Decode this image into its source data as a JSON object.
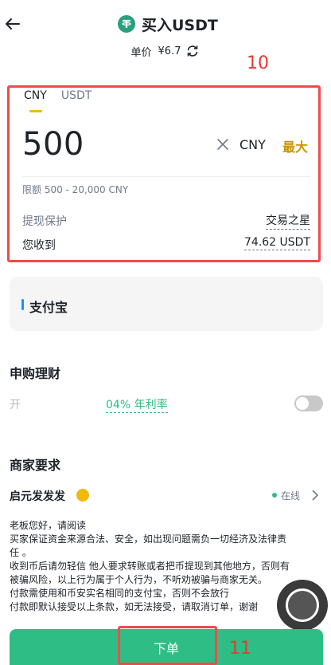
{
  "header": {
    "title": "买入USDT",
    "back_icon": "arrow-left-icon",
    "coin_icon": "tether-icon"
  },
  "price": {
    "label": "单价",
    "value": "¥6.7",
    "refresh_icon": "refresh-icon"
  },
  "annotations": {
    "box_label_1": "10",
    "box_label_2": "11"
  },
  "trade": {
    "tabs": [
      {
        "label": "CNY",
        "active": true
      },
      {
        "label": "USDT",
        "active": false
      }
    ],
    "amount": "500",
    "currency": "CNY",
    "max_label": "最大",
    "limit_text": "限额 500 - 20,000 CNY",
    "protection_label": "提现保护",
    "protection_value": "交易之星",
    "receive_label": "您收到",
    "receive_value": "74.62 USDT"
  },
  "payment": {
    "method": "支付宝"
  },
  "subscription": {
    "title": "申购理财",
    "left_text": "开",
    "apy_text": "04% 年利率",
    "toggle_on": false
  },
  "merchant": {
    "section_title": "商家要求",
    "name": "启元发发发",
    "status": "在线",
    "terms": [
      "老板您好，请阅读",
      "买家保证资金来源合法、安全，如出现问题需负一切经济及法律责",
      "任 。",
      "收到币后请勿轻信 他人要求转账或者把币提现到其他地方，否则有",
      "被骗风险，以上行为属于个人行为，不听劝被骗与商家无关。",
      "付款需使用和币安实名相同的支付宝，否则不会放行",
      "付款即默认接受以上条款，如无法接受，请取消订单，谢谢"
    ]
  },
  "footer": {
    "order_button": "下单"
  },
  "colors": {
    "accent_green": "#2ebd85",
    "accent_yellow": "#f0b90b",
    "annotation_red": "#ef4b4b",
    "tether_green": "#26a17b"
  }
}
